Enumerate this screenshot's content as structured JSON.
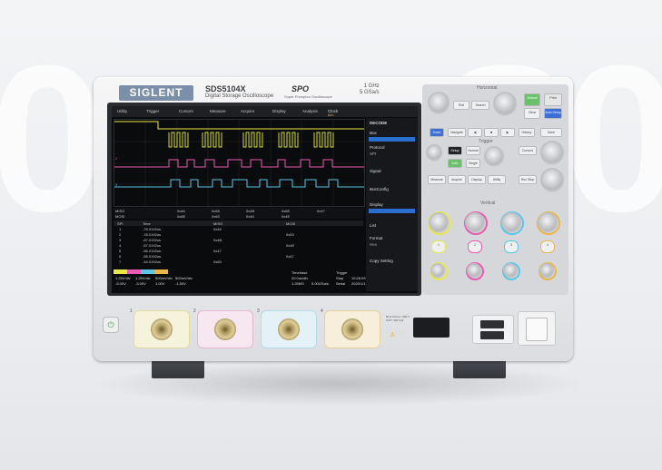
{
  "header": {
    "brand": "SIGLENT",
    "model": "SDS5104X",
    "subtitle": "Digital Storage Oscilloscope",
    "series_logo": "SPO",
    "series_tag": "Super Phosphor Oscilloscope",
    "bandwidth": "1 GHz",
    "sample_rate": "5 GSa/s"
  },
  "screen": {
    "menu": [
      "Utility",
      "Trigger",
      "Cursors",
      "Measure",
      "Acquire",
      "Display",
      "Analysis"
    ],
    "clock_label": "Clock",
    "clock_state": "Arm",
    "right_menu_title": "DECODE",
    "right_menu_items": [
      "Bus",
      "Protocol",
      "SPI",
      "Signal",
      "BusConfig",
      "Display",
      "List",
      "Format",
      "Hex",
      "Copy Setting"
    ],
    "bus_labels": [
      "MISO",
      "MOSI"
    ],
    "bus_values": [
      "0x46",
      "0x58",
      "0x4B",
      "0x6E",
      "0x47",
      "0x6E",
      "0x65",
      "0x46",
      "0x4E"
    ],
    "table_header": [
      "SPI",
      "Time",
      "MISO",
      "MOSI"
    ],
    "table_rows": [
      [
        "1",
        "-78.0192us",
        "0x46",
        ""
      ],
      [
        "2",
        "-78.0192us",
        "",
        "0x53"
      ],
      [
        "3",
        "-67.0192us",
        "0x4B",
        ""
      ],
      [
        "4",
        "-67.0192us",
        "",
        "0x4E"
      ],
      [
        "5",
        "-56.0192us",
        "0x47",
        ""
      ],
      [
        "6",
        "-55.0192us",
        "",
        "0x47"
      ],
      [
        "7",
        "-44.0192us",
        "0x65",
        ""
      ]
    ],
    "status": {
      "ch_scale": [
        "1.25V/div",
        "1.25V/div",
        "500mV/div",
        "500mV/div"
      ],
      "ch_offset": [
        "-5.00V",
        "-3.00V",
        "1.00V",
        "-1.50V"
      ],
      "timebase_label": "Timebase",
      "timebase": "20.0us/div",
      "sample": "1.25MS",
      "rate": "5.00GSa/s",
      "trigger_label": "Trigger",
      "trigger_mode": "Stop",
      "trigger_type": "Serial",
      "time": "10:26:09",
      "date": "2020/1/1"
    }
  },
  "panel": {
    "sections": [
      "Horizontal",
      "Trigger",
      "Vertical"
    ],
    "buttons": [
      "Default",
      "Auto Setup",
      "Zoom",
      "Navigate",
      "Roll",
      "Search",
      "Clear Sweep",
      "Run Stop",
      "Single",
      "Normal",
      "Auto",
      "Setup",
      "History",
      "Cursors",
      "Measure",
      "Acquire",
      "Display",
      "Utility",
      "Print",
      "Save"
    ]
  },
  "front": {
    "power_icon": "⏻",
    "channel_numbers": [
      "1",
      "2",
      "3",
      "4"
    ],
    "spec_text": "50 Ω  5Vrms / 300 V CAT I 400 Vpk"
  },
  "colors": {
    "ch1": "#e8e84a",
    "ch2": "#e85bb0",
    "ch3": "#5ac6e8",
    "ch4": "#e8b64a"
  }
}
